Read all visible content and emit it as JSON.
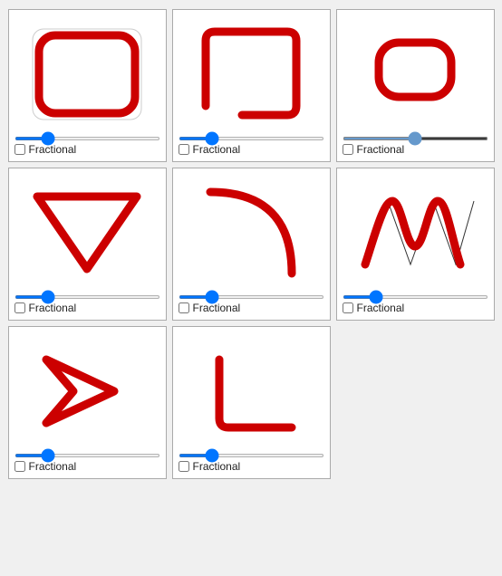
{
  "cards": [
    {
      "id": "rounded-rect-full",
      "label": "Fractional",
      "slider_value": 20,
      "slider_min": 0,
      "slider_max": 100,
      "checked": false
    },
    {
      "id": "rounded-rect-partial",
      "label": "Fractional",
      "slider_value": 20,
      "slider_min": 0,
      "slider_max": 100,
      "checked": false
    },
    {
      "id": "rounded-rect-slider-mid",
      "label": "Fractional",
      "slider_value": 50,
      "slider_min": 0,
      "slider_max": 100,
      "checked": false
    },
    {
      "id": "triangle",
      "label": "Fractional",
      "slider_value": 20,
      "slider_min": 0,
      "slider_max": 100,
      "checked": false
    },
    {
      "id": "curve-corner",
      "label": "Fractional",
      "slider_value": 20,
      "slider_min": 0,
      "slider_max": 100,
      "checked": false
    },
    {
      "id": "wave",
      "label": "Fractional",
      "slider_value": 20,
      "slider_min": 0,
      "slider_max": 100,
      "checked": false
    },
    {
      "id": "arrow",
      "label": "Fractional",
      "slider_value": 20,
      "slider_min": 0,
      "slider_max": 100,
      "checked": false
    },
    {
      "id": "corner-bracket",
      "label": "Fractional",
      "slider_value": 20,
      "slider_min": 0,
      "slider_max": 100,
      "checked": false
    }
  ]
}
